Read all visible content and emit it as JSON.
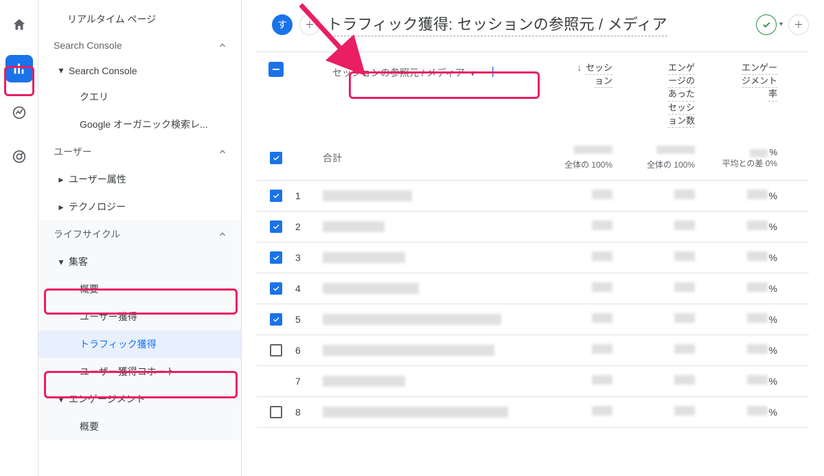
{
  "iconrail": {
    "home": "home-icon",
    "reports": "bar-chart-icon",
    "explore": "trend-icon",
    "ads": "target-icon"
  },
  "sidebar": {
    "realtime_page": "リアルタイム ページ",
    "search_console": {
      "label": "Search Console",
      "group": "Search Console",
      "items": [
        "クエリ",
        "Google オーガニック検索レ..."
      ]
    },
    "user": {
      "label": "ユーザー",
      "items": [
        "ユーザー属性",
        "テクノロジー"
      ]
    },
    "lifecycle": {
      "label": "ライフサイクル",
      "acquisition": {
        "label": "集客",
        "items": [
          "概要",
          "ユーザー獲得",
          "トラフィック獲得",
          "ユーザー獲得コホート"
        ]
      },
      "engagement": {
        "label": "エンゲージメント",
        "items": [
          "概要"
        ]
      }
    }
  },
  "header": {
    "back_label": "す",
    "title": "トラフィック獲得: セッションの参照元 / メディア"
  },
  "table": {
    "dimension_selector": "セッションの参照元 / メディア",
    "metrics": [
      {
        "lines": [
          "セッシ",
          "ョン"
        ],
        "has_arrow": true
      },
      {
        "lines": [
          "エンゲ",
          "ージの",
          "あった",
          "セッシ",
          "ョン数"
        ],
        "has_arrow": false
      },
      {
        "lines": [
          "エンゲー",
          "ジメント",
          "率"
        ],
        "has_arrow": false
      }
    ],
    "summary": {
      "label": "合計",
      "subs": [
        "全体の 100%",
        "全体の 100%",
        "平均との差 0%"
      ]
    },
    "rows": [
      {
        "n": "1",
        "checked": true,
        "dim_w": 130
      },
      {
        "n": "2",
        "checked": true,
        "dim_w": 90
      },
      {
        "n": "3",
        "checked": true,
        "dim_w": 120
      },
      {
        "n": "4",
        "checked": true,
        "dim_w": 140
      },
      {
        "n": "5",
        "checked": true,
        "dim_w": 260
      },
      {
        "n": "6",
        "checked": false,
        "dim_w": 250
      },
      {
        "n": "7",
        "checked": null,
        "dim_w": 120
      },
      {
        "n": "8",
        "checked": false,
        "dim_w": 270
      }
    ],
    "pct_suffix": "%"
  }
}
